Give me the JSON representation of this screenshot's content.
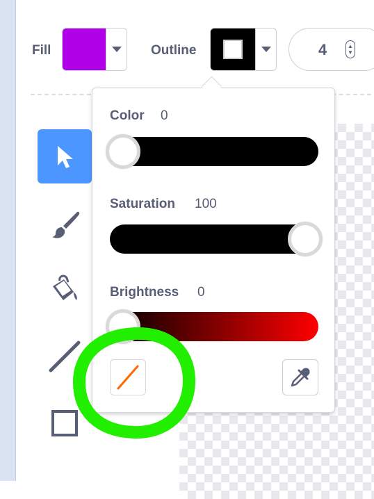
{
  "toolbar": {
    "fill_label": "Fill",
    "outline_label": "Outline",
    "stroke_width": "4"
  },
  "colors": {
    "fill": "#b000e8",
    "outline": "#000000",
    "accent": "#4c97ff",
    "annotation": "#22ee00",
    "no_color_slash": "#ff6a00"
  },
  "tools": [
    {
      "name": "select",
      "icon": "arrow-pointer-icon",
      "selected": true
    },
    {
      "name": "brush",
      "icon": "brush-icon",
      "selected": false
    },
    {
      "name": "fill",
      "icon": "paint-bucket-icon",
      "selected": false
    },
    {
      "name": "line",
      "icon": "line-icon",
      "selected": false
    },
    {
      "name": "rectangle",
      "icon": "rectangle-icon",
      "selected": false
    }
  ],
  "popover": {
    "color_label": "Color",
    "color_value": "0",
    "saturation_label": "Saturation",
    "saturation_value": "100",
    "brightness_label": "Brightness",
    "brightness_value": "0"
  },
  "sliders": {
    "color_level": 0,
    "saturation_level": 1,
    "brightness_level": 0
  },
  "icons": {
    "no_color": "no-color-slash-icon",
    "eyedropper": "eyedropper-icon"
  }
}
